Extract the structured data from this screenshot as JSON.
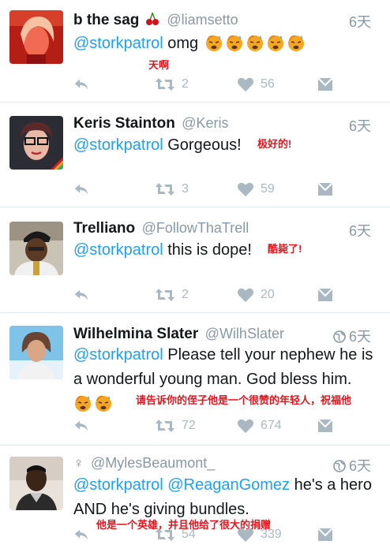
{
  "tweets": [
    {
      "name": "b the sag",
      "handle": "@liamsetto",
      "time": "6天",
      "mention": "@storkpatrol",
      "text": "omg",
      "translation": "天啊",
      "retweets": "2",
      "likes": "56"
    },
    {
      "name": "Keris Stainton",
      "handle": "@Keris",
      "time": "6天",
      "mention": "@storkpatrol",
      "text": "Gorgeous!",
      "translation": "极好的!",
      "retweets": "3",
      "likes": "59"
    },
    {
      "name": "Trelliano",
      "handle": "@FollowThaTrell",
      "time": "6天",
      "mention": "@storkpatrol",
      "text": "this is dope!",
      "translation": "酷毙了!",
      "retweets": "2",
      "likes": "20"
    },
    {
      "name": "Wilhelmina Slater",
      "handle": "@WilhSlater",
      "time": "6天",
      "mention": "@storkpatrol",
      "text_line1": "Please tell your nephew he is",
      "text_line2": "a wonderful young man. God bless him.",
      "translation": "请告诉你的侄子他是一个很赞的年轻人，祝福他",
      "retweets": "72",
      "likes": "674"
    },
    {
      "name": "♀",
      "handle": "@MylesBeaumont_",
      "time": "6天",
      "mention": "@storkpatrol",
      "mention2": "@ReaganGomez",
      "text_line1": "he's a hero",
      "text_line2": "AND he's giving bundles.",
      "translation": "他是一个英雄，并且他给了很大的捐赠",
      "retweets": "54",
      "likes": "339"
    }
  ],
  "colors": {
    "mention": "#1da1f2",
    "translation": "#e8141b",
    "action_icon": "#aab8c2",
    "handle": "#8899a6"
  },
  "icons": [
    "reply-icon",
    "retweet-icon",
    "like-icon",
    "dm-icon",
    "globe-icon",
    "sweat-emoji-icon"
  ]
}
